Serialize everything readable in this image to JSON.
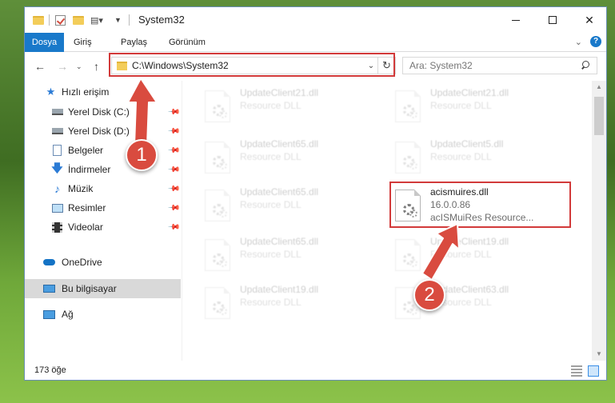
{
  "window": {
    "title": "System32",
    "controls": {
      "minimize": "minimize-icon",
      "maximize": "maximize-icon",
      "close": "✕"
    }
  },
  "ribbon": {
    "tabs": [
      "Dosya",
      "Giriş",
      "Paylaş",
      "Görünüm"
    ],
    "active_tab": "Dosya",
    "accent": "#1979ca"
  },
  "address": {
    "path": "C:\\Windows\\System32",
    "search_placeholder": "Ara: System32"
  },
  "sidebar": {
    "items": [
      {
        "label": "Hızlı erişim",
        "icon": "star-icon",
        "pinned": false
      },
      {
        "label": "Yerel Disk (C:)",
        "icon": "drive-icon",
        "pinned": true
      },
      {
        "label": "Yerel Disk (D:)",
        "icon": "drive-icon",
        "pinned": true
      },
      {
        "label": "Belgeler",
        "icon": "document-icon",
        "pinned": true
      },
      {
        "label": "İndirmeler",
        "icon": "download-icon",
        "pinned": true
      },
      {
        "label": "Müzik",
        "icon": "music-icon",
        "pinned": true
      },
      {
        "label": "Resimler",
        "icon": "pictures-icon",
        "pinned": true
      },
      {
        "label": "Videolar",
        "icon": "video-icon",
        "pinned": true
      },
      {
        "label": "OneDrive",
        "icon": "cloud-icon",
        "pinned": false
      },
      {
        "label": "Bu bilgisayar",
        "icon": "computer-icon",
        "pinned": false,
        "selected": true
      },
      {
        "label": "Ağ",
        "icon": "network-icon",
        "pinned": false
      }
    ]
  },
  "files": [
    {
      "name": "UpdateClient21.dll",
      "line2": "Resource DLL",
      "faded": true
    },
    {
      "name": "UpdateClient21.dll",
      "line2": "Resource DLL",
      "faded": true
    },
    {
      "name": "UpdateClient65.dll",
      "line2": "Resource DLL",
      "faded": true
    },
    {
      "name": "UpdateClient5.dll",
      "line2": "Resource DLL",
      "faded": true
    },
    {
      "name": "UpdateClient65.dll",
      "line2": "Resource DLL",
      "faded": true
    },
    {
      "name": "acismuires.dll",
      "line2": "16.0.0.86",
      "line3": "acISMuiRes Resource...",
      "faded": false
    },
    {
      "name": "UpdateClient65.dll",
      "line2": "Resource DLL",
      "faded": true
    },
    {
      "name": "UpdateClient19.dll",
      "line2": "Resource DLL",
      "faded": true
    },
    {
      "name": "UpdateClient19.dll",
      "line2": "Resource DLL",
      "faded": true
    },
    {
      "name": "UpdateClient63.dll",
      "line2": "Resource DLL",
      "faded": true
    }
  ],
  "status": {
    "item_count": "173 öğe"
  },
  "annotations": {
    "steps": [
      "1",
      "2"
    ],
    "color": "#d94b3f"
  }
}
